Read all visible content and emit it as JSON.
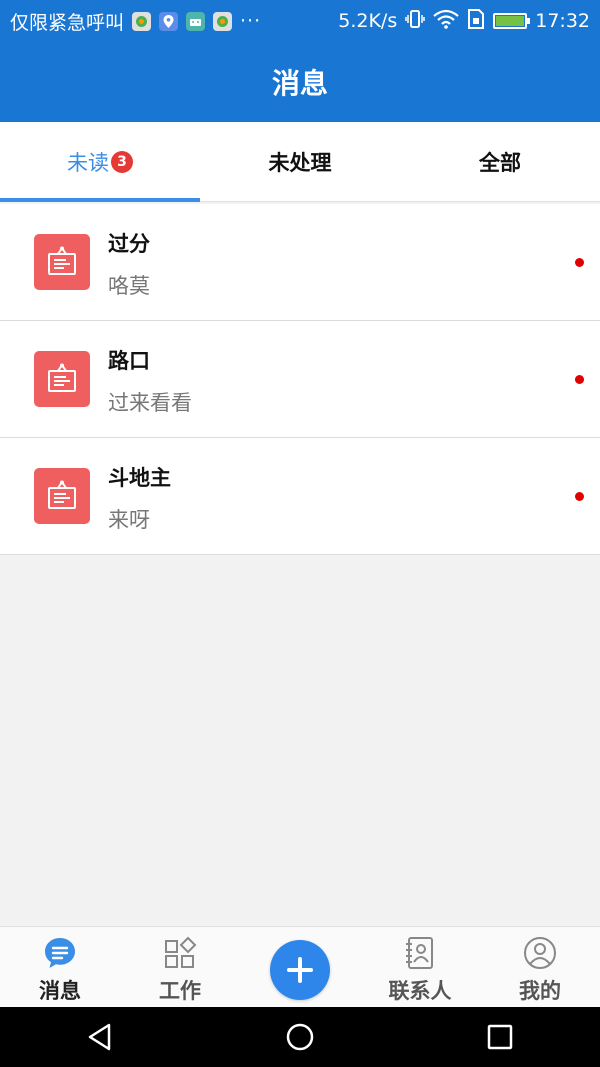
{
  "status_bar": {
    "carrier_text": "仅限紧急呼叫",
    "overflow": "···",
    "network_speed": "5.2K/s",
    "time": "17:32",
    "icons": [
      "app-notification-icon",
      "location-notification-icon",
      "android-notification-icon",
      "app-notification-icon",
      "vibrate-icon",
      "wifi-icon",
      "sim-icon",
      "battery-charging-icon"
    ]
  },
  "header": {
    "title": "消息"
  },
  "tabs": [
    {
      "label": "未读",
      "badge": "3",
      "active": true
    },
    {
      "label": "未处理",
      "active": false
    },
    {
      "label": "全部",
      "active": false
    }
  ],
  "messages": [
    {
      "title": "过分",
      "subtitle": "咯莫",
      "unread": true
    },
    {
      "title": "路口",
      "subtitle": "过来看看",
      "unread": true
    },
    {
      "title": "斗地主",
      "subtitle": "来呀",
      "unread": true
    }
  ],
  "bottom_nav": [
    {
      "label": "消息",
      "icon": "message-icon",
      "active": true
    },
    {
      "label": "工作",
      "icon": "apps-icon",
      "active": false
    },
    {
      "label": "",
      "icon": "plus-icon",
      "active": false
    },
    {
      "label": "联系人",
      "icon": "contacts-icon",
      "active": false
    },
    {
      "label": "我的",
      "icon": "profile-icon",
      "active": false
    }
  ],
  "colors": {
    "primary": "#1976d2",
    "tab_active": "#3a8ee6",
    "badge": "#e53935",
    "item_icon": "#f05f5f",
    "fab": "#2f86ea",
    "unread_dot": "#e00000"
  }
}
